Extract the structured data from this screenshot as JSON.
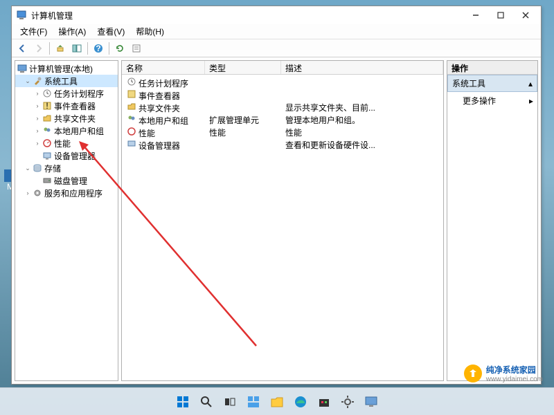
{
  "window": {
    "title": "计算机管理",
    "menus": [
      "文件(F)",
      "操作(A)",
      "查看(V)",
      "帮助(H)"
    ]
  },
  "tree": {
    "root": "计算机管理(本地)",
    "sys_tools": "系统工具",
    "task_scheduler": "任务计划程序",
    "event_viewer": "事件查看器",
    "shared_folders": "共享文件夹",
    "local_users": "本地用户和组",
    "performance": "性能",
    "device_manager": "设备管理器",
    "storage": "存储",
    "disk_mgmt": "磁盘管理",
    "services_apps": "服务和应用程序"
  },
  "list": {
    "columns": {
      "name": "名称",
      "type": "类型",
      "desc": "描述"
    },
    "rows": [
      {
        "name": "任务计划程序",
        "type": "",
        "desc": ""
      },
      {
        "name": "事件查看器",
        "type": "",
        "desc": ""
      },
      {
        "name": "共享文件夹",
        "type": "",
        "desc": "显示共享文件夹、目前..."
      },
      {
        "name": "本地用户和组",
        "type": "扩展管理单元",
        "desc": "管理本地用户和组。"
      },
      {
        "name": "性能",
        "type": "性能",
        "desc": "性能"
      },
      {
        "name": "设备管理器",
        "type": "",
        "desc": "查看和更新设备硬件设..."
      }
    ]
  },
  "actions": {
    "header": "操作",
    "group": "系统工具",
    "more": "更多操作"
  },
  "watermark": {
    "name": "纯净系统家园",
    "url": "www.yidaimei.com"
  },
  "desktop": {
    "icon_label": "M"
  }
}
